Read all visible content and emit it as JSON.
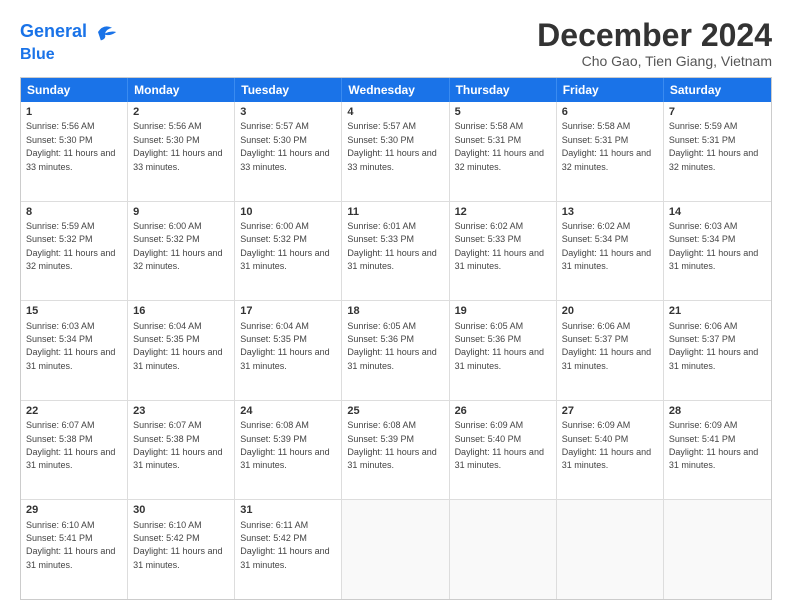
{
  "header": {
    "logo_line1": "General",
    "logo_line2": "Blue",
    "month_title": "December 2024",
    "location": "Cho Gao, Tien Giang, Vietnam"
  },
  "weekdays": [
    "Sunday",
    "Monday",
    "Tuesday",
    "Wednesday",
    "Thursday",
    "Friday",
    "Saturday"
  ],
  "weeks": [
    [
      {
        "day": "1",
        "sunrise": "5:56 AM",
        "sunset": "5:30 PM",
        "daylight": "11 hours and 33 minutes"
      },
      {
        "day": "2",
        "sunrise": "5:56 AM",
        "sunset": "5:30 PM",
        "daylight": "11 hours and 33 minutes"
      },
      {
        "day": "3",
        "sunrise": "5:57 AM",
        "sunset": "5:30 PM",
        "daylight": "11 hours and 33 minutes"
      },
      {
        "day": "4",
        "sunrise": "5:57 AM",
        "sunset": "5:30 PM",
        "daylight": "11 hours and 33 minutes"
      },
      {
        "day": "5",
        "sunrise": "5:58 AM",
        "sunset": "5:31 PM",
        "daylight": "11 hours and 32 minutes"
      },
      {
        "day": "6",
        "sunrise": "5:58 AM",
        "sunset": "5:31 PM",
        "daylight": "11 hours and 32 minutes"
      },
      {
        "day": "7",
        "sunrise": "5:59 AM",
        "sunset": "5:31 PM",
        "daylight": "11 hours and 32 minutes"
      }
    ],
    [
      {
        "day": "8",
        "sunrise": "5:59 AM",
        "sunset": "5:32 PM",
        "daylight": "11 hours and 32 minutes"
      },
      {
        "day": "9",
        "sunrise": "6:00 AM",
        "sunset": "5:32 PM",
        "daylight": "11 hours and 32 minutes"
      },
      {
        "day": "10",
        "sunrise": "6:00 AM",
        "sunset": "5:32 PM",
        "daylight": "11 hours and 31 minutes"
      },
      {
        "day": "11",
        "sunrise": "6:01 AM",
        "sunset": "5:33 PM",
        "daylight": "11 hours and 31 minutes"
      },
      {
        "day": "12",
        "sunrise": "6:02 AM",
        "sunset": "5:33 PM",
        "daylight": "11 hours and 31 minutes"
      },
      {
        "day": "13",
        "sunrise": "6:02 AM",
        "sunset": "5:34 PM",
        "daylight": "11 hours and 31 minutes"
      },
      {
        "day": "14",
        "sunrise": "6:03 AM",
        "sunset": "5:34 PM",
        "daylight": "11 hours and 31 minutes"
      }
    ],
    [
      {
        "day": "15",
        "sunrise": "6:03 AM",
        "sunset": "5:34 PM",
        "daylight": "11 hours and 31 minutes"
      },
      {
        "day": "16",
        "sunrise": "6:04 AM",
        "sunset": "5:35 PM",
        "daylight": "11 hours and 31 minutes"
      },
      {
        "day": "17",
        "sunrise": "6:04 AM",
        "sunset": "5:35 PM",
        "daylight": "11 hours and 31 minutes"
      },
      {
        "day": "18",
        "sunrise": "6:05 AM",
        "sunset": "5:36 PM",
        "daylight": "11 hours and 31 minutes"
      },
      {
        "day": "19",
        "sunrise": "6:05 AM",
        "sunset": "5:36 PM",
        "daylight": "11 hours and 31 minutes"
      },
      {
        "day": "20",
        "sunrise": "6:06 AM",
        "sunset": "5:37 PM",
        "daylight": "11 hours and 31 minutes"
      },
      {
        "day": "21",
        "sunrise": "6:06 AM",
        "sunset": "5:37 PM",
        "daylight": "11 hours and 31 minutes"
      }
    ],
    [
      {
        "day": "22",
        "sunrise": "6:07 AM",
        "sunset": "5:38 PM",
        "daylight": "11 hours and 31 minutes"
      },
      {
        "day": "23",
        "sunrise": "6:07 AM",
        "sunset": "5:38 PM",
        "daylight": "11 hours and 31 minutes"
      },
      {
        "day": "24",
        "sunrise": "6:08 AM",
        "sunset": "5:39 PM",
        "daylight": "11 hours and 31 minutes"
      },
      {
        "day": "25",
        "sunrise": "6:08 AM",
        "sunset": "5:39 PM",
        "daylight": "11 hours and 31 minutes"
      },
      {
        "day": "26",
        "sunrise": "6:09 AM",
        "sunset": "5:40 PM",
        "daylight": "11 hours and 31 minutes"
      },
      {
        "day": "27",
        "sunrise": "6:09 AM",
        "sunset": "5:40 PM",
        "daylight": "11 hours and 31 minutes"
      },
      {
        "day": "28",
        "sunrise": "6:09 AM",
        "sunset": "5:41 PM",
        "daylight": "11 hours and 31 minutes"
      }
    ],
    [
      {
        "day": "29",
        "sunrise": "6:10 AM",
        "sunset": "5:41 PM",
        "daylight": "11 hours and 31 minutes"
      },
      {
        "day": "30",
        "sunrise": "6:10 AM",
        "sunset": "5:42 PM",
        "daylight": "11 hours and 31 minutes"
      },
      {
        "day": "31",
        "sunrise": "6:11 AM",
        "sunset": "5:42 PM",
        "daylight": "11 hours and 31 minutes"
      },
      null,
      null,
      null,
      null
    ]
  ]
}
